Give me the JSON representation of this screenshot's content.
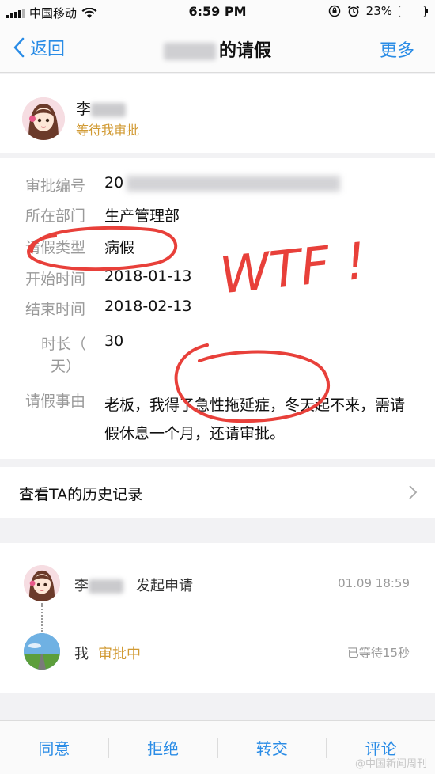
{
  "status_bar": {
    "carrier": "中国移动",
    "time": "6:59 PM",
    "battery": "23%",
    "battery_level": 0.23
  },
  "nav": {
    "back_label": "返回",
    "title_suffix": "的请假",
    "more_label": "更多"
  },
  "applicant": {
    "name": "李",
    "status": "等待我审批"
  },
  "details": {
    "serial": {
      "label": "审批编号",
      "value": "20"
    },
    "department": {
      "label": "所在部门",
      "value": "生产管理部"
    },
    "leave_type": {
      "label": "请假类型",
      "value": "病假"
    },
    "start": {
      "label": "开始时间",
      "value": "2018-01-13"
    },
    "end": {
      "label": "结束时间",
      "value": "2018-02-13"
    },
    "duration": {
      "label_line1": "时长（",
      "label_line2": "天）",
      "value": "30"
    },
    "reason": {
      "label": "请假事由",
      "value": "老板，我得了急性拖延症，冬天起不来，需请假休息一个月，还请审批。"
    }
  },
  "history": {
    "label": "查看TA的历史记录"
  },
  "timeline": [
    {
      "name": "李",
      "action": "发起申请",
      "time": "01.09 18:59"
    },
    {
      "name": "我",
      "status": "审批中",
      "time": "已等待15秒"
    }
  ],
  "actions": {
    "approve": "同意",
    "reject": "拒绝",
    "transfer": "转交",
    "comment": "评论"
  },
  "annotation": {
    "text": "WTF !",
    "color": "#e8403a"
  },
  "watermark": "@中国新闻周刊",
  "colors": {
    "accent": "#2a8ce6",
    "pending": "#d19a33",
    "annotation": "#e8403a"
  }
}
